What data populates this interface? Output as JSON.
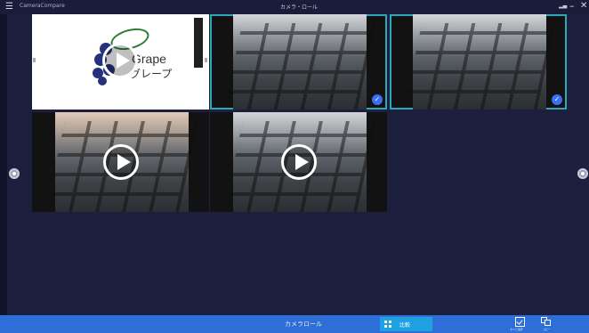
{
  "titlebar": {
    "menu_icon": "hamburger-icon",
    "app_title": "CameraCompare",
    "center_title": "カメラ・ロール",
    "signal_icon": "signal-icon",
    "minimize_glyph": "–",
    "close_glyph": "✕"
  },
  "gallery": {
    "tiles": [
      {
        "kind": "video",
        "content": "logo-slide",
        "selected": false
      },
      {
        "kind": "photo",
        "content": "keyboard",
        "selected": true
      },
      {
        "kind": "photo",
        "content": "keyboard",
        "selected": true
      },
      {
        "kind": "video",
        "content": "keyboard-hand",
        "selected": false
      },
      {
        "kind": "video",
        "content": "keyboard",
        "selected": false
      }
    ],
    "logo": {
      "line1": "Grape",
      "line2": "グレープ"
    },
    "check_glyph": "✓"
  },
  "bottombar": {
    "camera_roll_label": "カメラロール",
    "compare_label": "比較",
    "select_all_caption": "すべて選択",
    "copy_caption": "コピー"
  },
  "colors": {
    "accent": "#2d6fd6",
    "selection": "#2ea8b8",
    "check": "#3a6ff2",
    "background": "#1c1f3e"
  }
}
